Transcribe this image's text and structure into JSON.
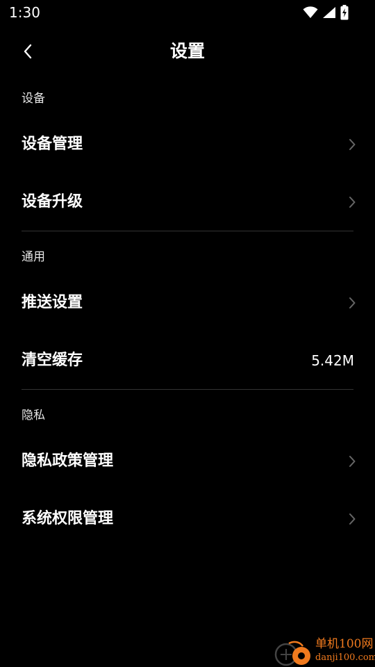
{
  "status_bar": {
    "time": "1:30",
    "icons": [
      "wifi-icon",
      "cell-signal-icon",
      "battery-charging-icon"
    ]
  },
  "header": {
    "back_icon": "chevron-left-icon",
    "title": "设置"
  },
  "sections": [
    {
      "header": "设备",
      "items": [
        {
          "label": "设备管理",
          "trailing": "chevron-right-icon"
        },
        {
          "label": "设备升级",
          "trailing": "chevron-right-icon"
        }
      ]
    },
    {
      "header": "通用",
      "items": [
        {
          "label": "推送设置",
          "trailing": "chevron-right-icon"
        },
        {
          "label": "清空缓存",
          "value": "5.42M"
        }
      ]
    },
    {
      "header": "隐私",
      "items": [
        {
          "label": "隐私政策管理",
          "trailing": "chevron-right-icon"
        },
        {
          "label": "系统权限管理",
          "trailing": "chevron-right-icon"
        }
      ]
    }
  ],
  "watermark": {
    "text_cn": "单机100网",
    "text_en": "danji100.com"
  },
  "colors": {
    "background": "#000000",
    "text": "#ffffff",
    "divider": "#333333",
    "chevron": "#666666",
    "watermark": "#f07a1e"
  }
}
